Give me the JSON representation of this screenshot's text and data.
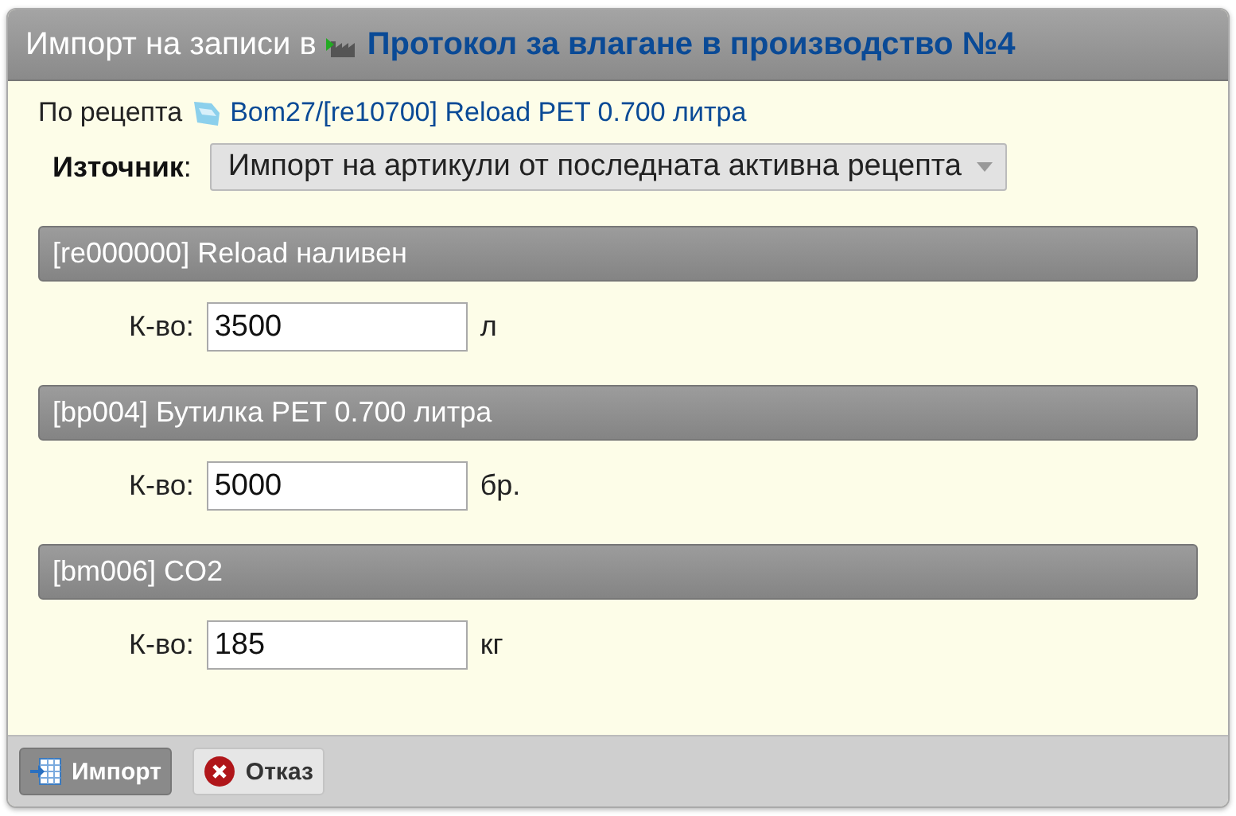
{
  "dialog": {
    "title_prefix": "Импорт на записи в",
    "title_link": "Протокол за влагане в производство №4"
  },
  "recipe": {
    "label": "По рецепта",
    "link": "Bom27/[re10700] Reload PET 0.700 литра"
  },
  "source": {
    "label": "Източник",
    "separator": ":",
    "value": "Импорт на артикули от последната активна рецепта"
  },
  "items": [
    {
      "title": "[re000000] Reload наливен",
      "qty_label": "К-во:",
      "value": "3500",
      "unit": "л"
    },
    {
      "title": "[bp004] Бутилка PET 0.700 литра",
      "qty_label": "К-во:",
      "value": "5000",
      "unit": "бр."
    },
    {
      "title": "[bm006] CO2",
      "qty_label": "К-во:",
      "value": "185",
      "unit": "кг"
    }
  ],
  "buttons": [
    {
      "label": "Импорт",
      "kind": "primary"
    },
    {
      "label": "Отказ",
      "kind": "cancel"
    }
  ]
}
